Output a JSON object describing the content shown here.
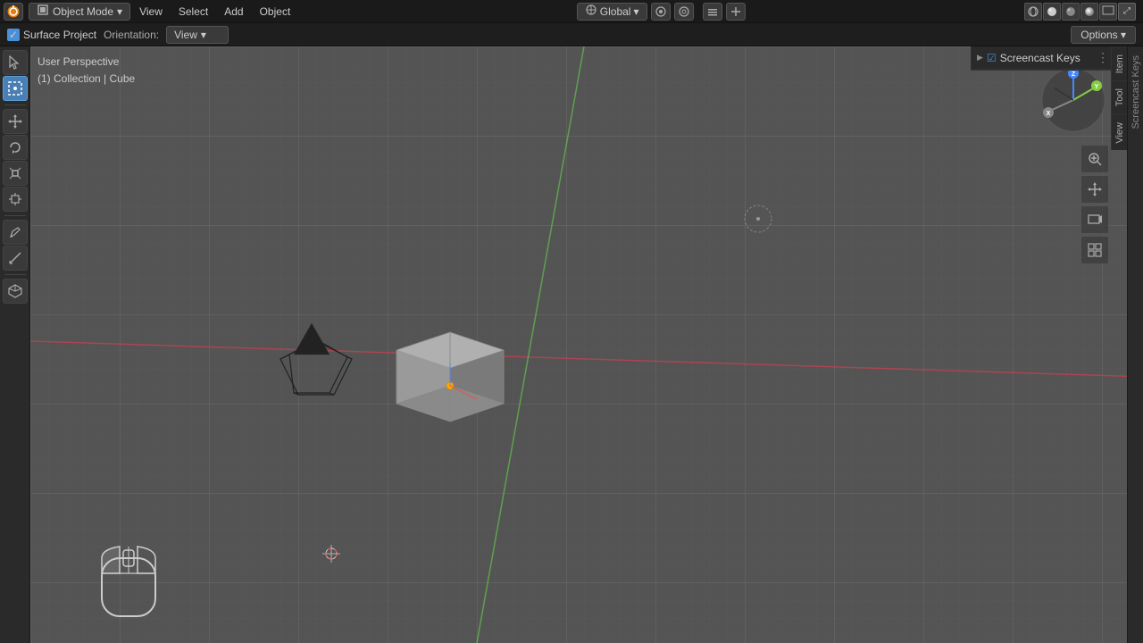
{
  "app": {
    "title": "Blender"
  },
  "top_menu": {
    "mode_label": "Object Mode",
    "menu_items": [
      "View",
      "Select",
      "Add",
      "Object"
    ],
    "global_label": "Global",
    "options_label": "Options ▾"
  },
  "second_bar": {
    "checkbox_label": "Surface Project",
    "orientation_label": "Orientation:",
    "orientation_value": "View",
    "options_label": "Options ▾"
  },
  "viewport": {
    "perspective_label": "User Perspective",
    "collection_label": "(1) Collection | Cube"
  },
  "screencast": {
    "header_label": "Screencast Keys",
    "vertical_label": "Screencast Keys"
  },
  "right_tabs": {
    "item": "Item",
    "tool": "Tool",
    "view": "View"
  },
  "axis_gizmo": {
    "x_color": "#ff4444",
    "y_color": "#88cc44",
    "z_color": "#4488ff",
    "x_label": "X",
    "y_label": "Y",
    "z_label": "Z"
  },
  "tools": {
    "cursor_label": "Cursor",
    "select_label": "Select Box",
    "move_label": "Move",
    "rotate_label": "Rotate",
    "scale_label": "Scale",
    "transform_label": "Transform",
    "annotate_label": "Annotate",
    "measure_label": "Measure",
    "add_cube_label": "Add Cube"
  }
}
